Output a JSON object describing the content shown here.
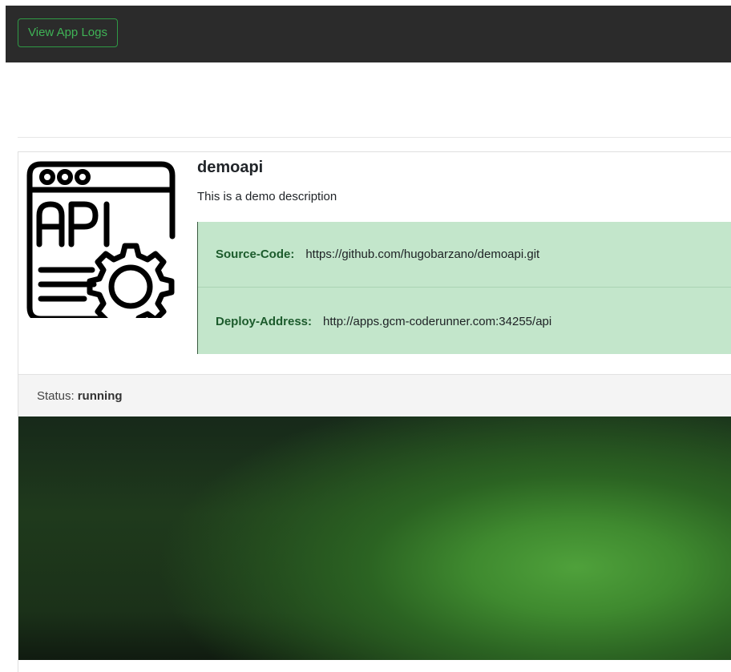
{
  "toolbar": {
    "view_logs_label": "View App Logs"
  },
  "app": {
    "name": "demoapi",
    "description": "This is a demo description",
    "icon": "api-window-gear-icon"
  },
  "info": {
    "source_label": "Source-Code:",
    "source_value": "https://github.com/hugobarzano/demoapi.git",
    "deploy_label": "Deploy-Address:",
    "deploy_value": "http://apps.gcm-coderunner.com:34255/api"
  },
  "status": {
    "label": "Status:",
    "value": "running"
  },
  "colors": {
    "accent_green": "#3fb356",
    "info_bg": "#c3e6cb",
    "info_label": "#1c5b2c",
    "topbar_bg": "#2b2b2b"
  }
}
